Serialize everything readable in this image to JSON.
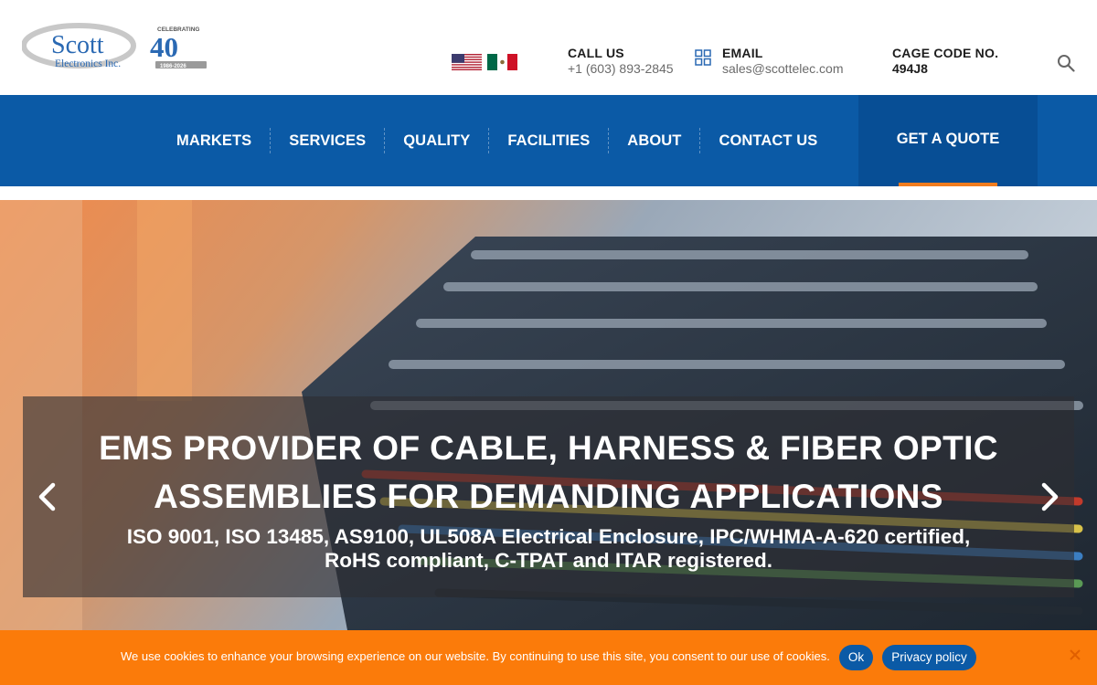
{
  "brand": {
    "logo_name": "Scott",
    "logo_subtitle": "Electronics Inc.",
    "anniversary_label": "CELEBRATING",
    "anniversary_number": "40",
    "anniversary_years": "1986-2026"
  },
  "header": {
    "call": {
      "title": "CALL US",
      "value": "+1 (603) 893-2845"
    },
    "email": {
      "title": "EMAIL",
      "value": "sales@scottelec.com"
    },
    "cage": {
      "title": "CAGE CODE NO.",
      "value": "494J8"
    },
    "flags": [
      "us-flag-icon",
      "mexico-flag-icon"
    ]
  },
  "nav": {
    "items": [
      "MARKETS",
      "SERVICES",
      "QUALITY",
      "FACILITIES",
      "ABOUT",
      "CONTACT US"
    ],
    "cta": "GET A QUOTE"
  },
  "hero": {
    "title_line1": "EMS PROVIDER OF CABLE, HARNESS & FIBER OPTIC",
    "title_line2": "ASSEMBLIES FOR DEMANDING APPLICATIONS",
    "subtitle_line1": "ISO 9001, ISO 13485, AS9100, UL508A Electrical Enclosure, IPC/WHMA-A-620 certified,",
    "subtitle_line2": "RoHS compliant, C-TPAT and ITAR registered."
  },
  "cookie": {
    "text": "We use cookies to enhance your browsing experience on our website. By continuing to use this site, you consent to our use of cookies.",
    "ok_label": "Ok",
    "policy_label": "Privacy policy"
  },
  "colors": {
    "nav_blue": "#0b5aa6",
    "cta_blue": "#074e95",
    "accent_orange": "#f07c1e",
    "cookie_orange": "#fb7b0a"
  }
}
